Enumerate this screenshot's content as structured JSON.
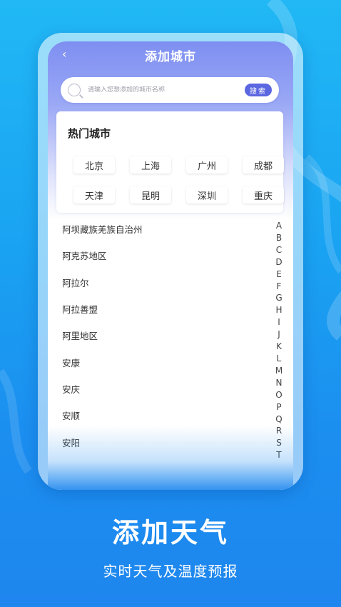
{
  "nav": {
    "title": "添加城市"
  },
  "search": {
    "placeholder": "请输入您想添加的城市名称",
    "button": "搜索"
  },
  "hot": {
    "title": "热门城市",
    "cities": [
      "北京",
      "上海",
      "广州",
      "成都",
      "天津",
      "昆明",
      "深圳",
      "重庆"
    ]
  },
  "cities": [
    "阿坝藏族羌族自治州",
    "阿克苏地区",
    "阿拉尔",
    "阿拉善盟",
    "阿里地区",
    "安康",
    "安庆",
    "安顺",
    "安阳"
  ],
  "index": [
    "A",
    "B",
    "C",
    "D",
    "E",
    "F",
    "G",
    "H",
    "I",
    "J",
    "K",
    "L",
    "M",
    "N",
    "O",
    "P",
    "Q",
    "R",
    "S",
    "T"
  ],
  "promo": {
    "headline": "添加天气",
    "subline": "实时天气及温度预报"
  }
}
